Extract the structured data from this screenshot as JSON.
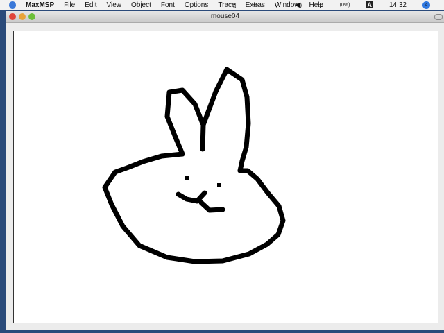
{
  "menubar": {
    "items": [
      "MaxMSP",
      "File",
      "Edit",
      "View",
      "Object",
      "Font",
      "Options",
      "Trace",
      "Extras",
      "Window",
      "Help"
    ],
    "battery": "(0%)",
    "clock": "14:32",
    "input_menu": "A"
  },
  "window": {
    "title": "mouse04"
  },
  "drawing": {
    "subject": "bunny",
    "stroke_color": "#000000"
  }
}
